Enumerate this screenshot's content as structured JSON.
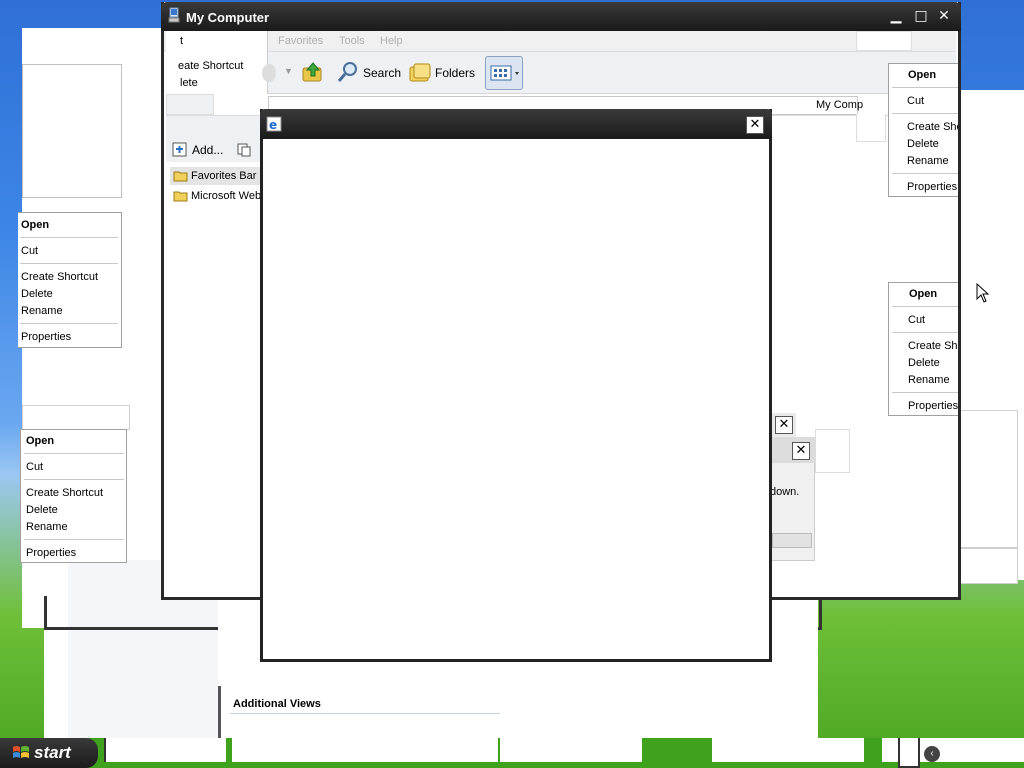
{
  "my_computer": {
    "title": "My Computer",
    "menu": {
      "frag": "t",
      "favorites": "Favorites",
      "tools": "Tools",
      "help": "Help"
    },
    "edit_menu_frag": {
      "create_shortcut": "eate Shortcut",
      "delete": "lete"
    },
    "toolbar": {
      "search": "Search",
      "folders": "Folders"
    },
    "address_frag": "My Comp",
    "favorites_toolbar": {
      "add": "Add..."
    },
    "tree_items": [
      "Favorites Bar",
      "Microsoft Web"
    ]
  },
  "ie_dialog": {
    "close_glyph": "✕"
  },
  "context_menus": {
    "open": "Open",
    "cut": "Cut",
    "create_shortcut": "Create Shortcut",
    "delete": "Delete",
    "rename": "Rename",
    "properties": "Properties",
    "create_sh_frag": "Create Sh",
    "create_she_frag": "Create She"
  },
  "bg_dialog": {
    "text_frag": "down."
  },
  "additional_views": "Additional Views",
  "taskbar": {
    "start_label": "start"
  },
  "colors": {
    "titlebar": "#1f1f1f",
    "taskbar_green": "#3fa21c",
    "start_button": "#2b2b2b"
  }
}
